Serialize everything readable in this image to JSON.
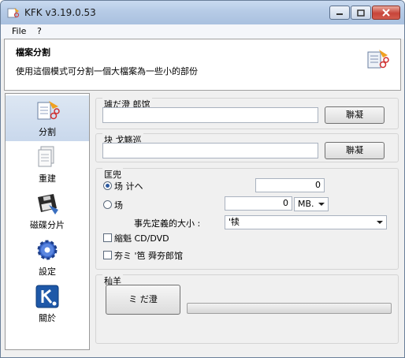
{
  "window": {
    "title": "KFK v3.19.0.53"
  },
  "menu": {
    "items": [
      "File",
      "?"
    ]
  },
  "header": {
    "title": "檔案分割",
    "description": "使用這個模式可分割一個大檔案為一些小的部份"
  },
  "sidebar": {
    "items": [
      {
        "label": "分割",
        "icon": "split-icon"
      },
      {
        "label": "重建",
        "icon": "rebuild-icon"
      },
      {
        "label": "磁碟分片",
        "icon": "floppy-disk-icon"
      },
      {
        "label": "設定",
        "icon": "settings-gear-icon"
      },
      {
        "label": "關於",
        "icon": "about-k-icon"
      }
    ]
  },
  "source_group": {
    "label": "璩だ澄 郎馆",
    "value": "",
    "button": "聨凝"
  },
  "dest_group": {
    "label": "块 戈觞巡",
    "value": "",
    "button": "聨凝"
  },
  "options_group": {
    "label": "匡兜",
    "radio1_label": "场 计ヘ",
    "radio1_value": "0",
    "radio2_label": "场",
    "radio2_value": "0",
    "unit": "MB.",
    "preset_label": "事先定義的大小 :",
    "preset_value": "'犊",
    "check1_label": "縮魁 CD/DVD",
    "check2_label": "夯ミ '笆 舜夯郎馆"
  },
  "action_group": {
    "label": "秈羊",
    "button": "ミ だ澄",
    "progress": 0
  }
}
